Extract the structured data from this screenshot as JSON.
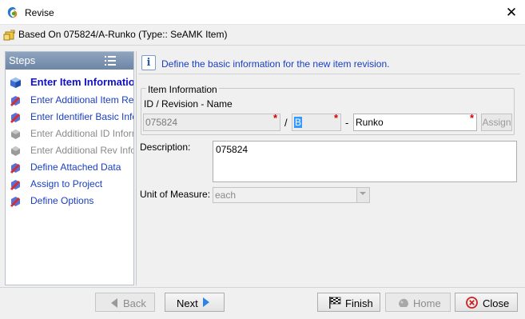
{
  "window": {
    "title": "Revise"
  },
  "subheader": {
    "text": "Based On 075824/A-Runko (Type:: SeAMK Item)"
  },
  "steps": {
    "title": "Steps",
    "items": [
      {
        "label": "Enter Item Information",
        "state": "active"
      },
      {
        "label": "Enter Additional Item Revision Information",
        "state": "enabled"
      },
      {
        "label": "Enter Identifier Basic Information",
        "state": "enabled"
      },
      {
        "label": "Enter Additional ID Information",
        "state": "disabled"
      },
      {
        "label": "Enter Additional Rev Information",
        "state": "disabled"
      },
      {
        "label": "Define Attached Data",
        "state": "enabled"
      },
      {
        "label": "Assign to Project",
        "state": "enabled"
      },
      {
        "label": "Define Options",
        "state": "enabled"
      }
    ]
  },
  "info": {
    "text": "Define the basic information for the new item revision.",
    "icon": "info-icon"
  },
  "item_info": {
    "group_title": "Item Information",
    "id_rev_name_label": "ID / Revision - Name",
    "id_value": "075824",
    "id_rev_separator": "/",
    "revision_value": "B",
    "rev_name_separator": "-",
    "name_value": "Runko",
    "assign_label": "Assign"
  },
  "description": {
    "label": "Description:",
    "value": "075824"
  },
  "unit_of_measure": {
    "label": "Unit of Measure:",
    "value": "each"
  },
  "buttons": {
    "back": "Back",
    "next": "Next",
    "finish": "Finish",
    "home": "Home",
    "close": "Close"
  },
  "colors": {
    "accent": "#1a3ec0",
    "required": "#d40000",
    "steps_header": "#7890ae"
  }
}
